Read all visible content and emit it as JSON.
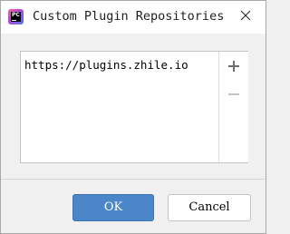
{
  "window": {
    "title": "Custom Plugin Repositories",
    "app_icon": "pycharm-icon",
    "app_icon_text": "PC",
    "close_icon": "close-icon"
  },
  "repositories": {
    "items": [
      "https://plugins.zhile.io"
    ],
    "toolbar": {
      "add_icon": "plus-icon",
      "remove_icon": "minus-icon"
    }
  },
  "buttons": {
    "ok_label": "OK",
    "cancel_label": "Cancel"
  },
  "colors": {
    "primary_button": "#4a86c8",
    "dialog_background": "#f0f0f0",
    "list_background": "#ffffff"
  }
}
